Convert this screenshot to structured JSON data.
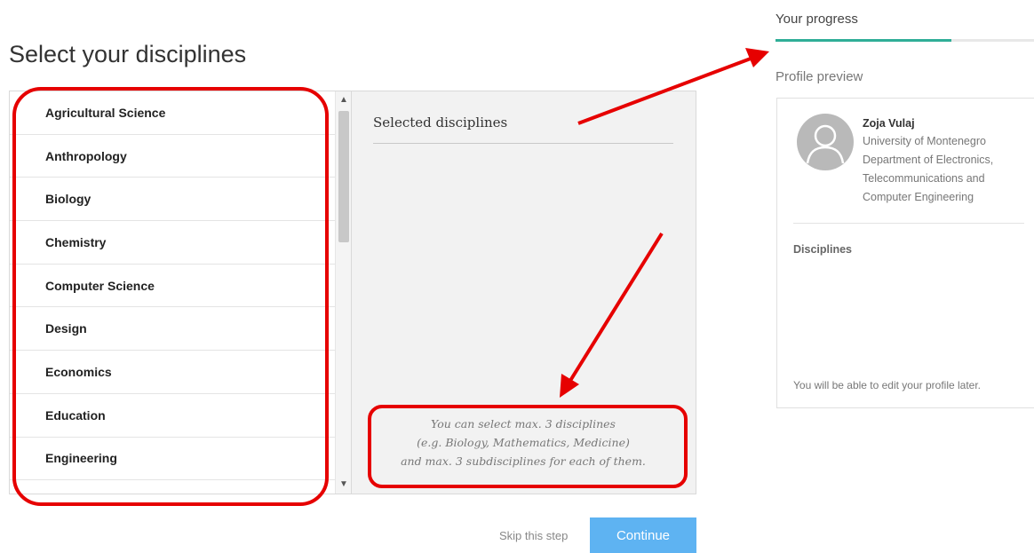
{
  "page": {
    "title": "Select your disciplines"
  },
  "disciplines": {
    "items": [
      "Agricultural Science",
      "Anthropology",
      "Biology",
      "Chemistry",
      "Computer Science",
      "Design",
      "Economics",
      "Education",
      "Engineering"
    ]
  },
  "selected": {
    "title": "Selected disciplines",
    "hint_lines": [
      "You can select max. 3 disciplines",
      "(e.g. Biology, Mathematics, Medicine)",
      "and max. 3 subdisciplines for each of them."
    ]
  },
  "actions": {
    "skip_label": "Skip this step",
    "continue_label": "Continue"
  },
  "progress": {
    "label": "Your progress",
    "value": 0.68
  },
  "profile": {
    "section_label": "Profile preview",
    "name": "Zoja Vulaj",
    "affiliation_lines": [
      "University of Montenegro",
      "Department of Electronics,",
      "Telecommunications and",
      "Computer Engineering"
    ],
    "disciplines_heading": "Disciplines",
    "edit_note": "You will be able to edit your profile later."
  },
  "colors": {
    "accent": "#2fae97",
    "button": "#5eb3f2",
    "annotation": "#e60000"
  },
  "icons": {
    "scroll_up": "chevron-up-icon",
    "scroll_down": "chevron-down-icon",
    "avatar": "user-silhouette-icon"
  }
}
